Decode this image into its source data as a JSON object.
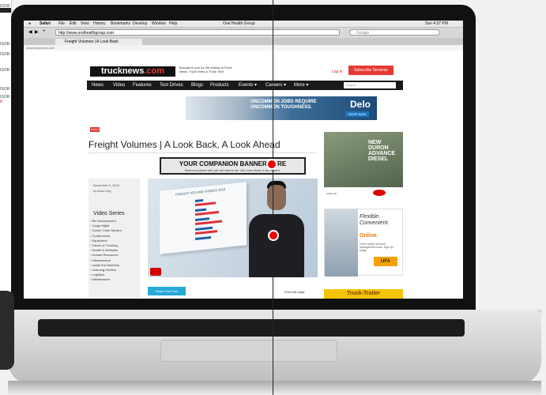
{
  "background_window": {
    "lines": [
      "DOW",
      "ISOR",
      "ISOR",
      "ISOR",
      "ISOR",
      "ISOR",
      "0"
    ]
  },
  "menubar": {
    "apple": "",
    "app": "Safari",
    "items": [
      "File",
      "Edit",
      "View",
      "History",
      "Bookmarks",
      "Develop",
      "Window",
      "Help"
    ],
    "window_title": "Oral Health Group",
    "status_right": "Sun 4:37 PM"
  },
  "browser": {
    "url": "http://www.oralhealthgroup.com",
    "search_placeholder": "Google",
    "tab_label": "Freight Volumes | A Look Back",
    "address_secondary": "www.trucknews.com"
  },
  "site": {
    "logo_main": "trucknews",
    "logo_dot": ".com",
    "tagline": "Brought to you by the editors of Truck News, Truck West & Truck Tech",
    "login_label": "Log in",
    "subscribe_label": "Subscribe Services",
    "nav": [
      "News",
      "Video",
      "Features",
      "Test Drives",
      "Blogs",
      "Products",
      "Events ▾",
      "Careers ▾",
      "More ▾"
    ],
    "nav_search_placeholder": "Search"
  },
  "banner_ad": {
    "headline": "UNCOMMON JOBS REQUIRE UNCOMMON TOUGHNESS.",
    "brand": "Delo",
    "cta": "SHOP NOW"
  },
  "article": {
    "badge": "Video",
    "title": "Freight Volumes | A Look Back, A Look Ahead",
    "date": "November 9, 2018",
    "author": "by Brad Ling",
    "share_label": "Share This Post",
    "print_label": "Print this page"
  },
  "companion_banner": {
    "headline": "YOUR COMPANION BANNER HERE",
    "subtext": "Banners paired with pre-roll videos are 18x more likely to be clicked."
  },
  "video_series": {
    "title": "Video Series",
    "items": [
      "Biz Development",
      "Cargo Might",
      "Carrier Case Studies",
      "Conferences",
      "Equipment",
      "Future of Trucking",
      "Health & Wellness",
      "Human Resources",
      "Infrastructure",
      "Inside the Numbers",
      "Learning Centers",
      "Logistics",
      "Maintenance"
    ]
  },
  "video": {
    "chart_title": "FREIGHT VOLUME TRENDS 2018"
  },
  "side_ads": {
    "dupont_headline": "NEW DURON ADVANCE DIESEL",
    "dupont_sub": "engine oil",
    "ufa_line1": "Flexible. Convenient.",
    "ufa_line2": "Online.",
    "ufa_small": "UFA's online account management tools. Sign up today.",
    "ufa_brand": "UFA",
    "trailer_label": "Truck-Trailer"
  },
  "colors": {
    "accent": "#e53935",
    "nav_bg": "#1a1a1a",
    "share_blue": "#29a9d9"
  }
}
